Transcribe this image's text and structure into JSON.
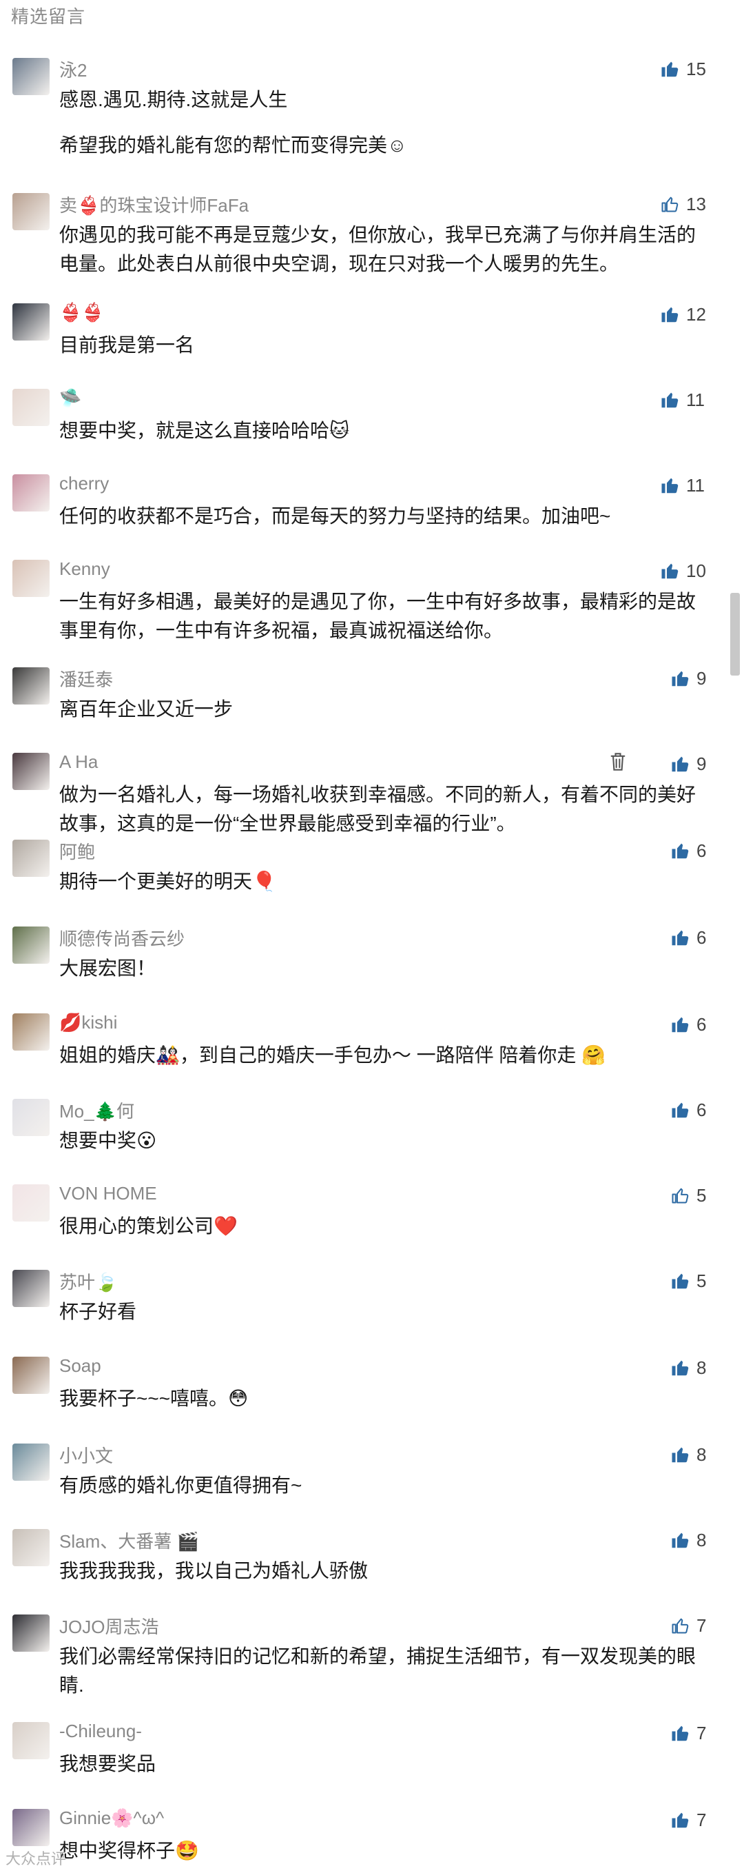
{
  "section_title": "精选留言",
  "comments": [
    {
      "name": "泳2",
      "texts": [
        "感恩.遇见.期待.这就是人生",
        "希望我的婚礼能有您的帮忙而变得完美☺"
      ],
      "likes": "15",
      "liked": true,
      "avatar_color": "#6b7a8c"
    },
    {
      "name": "卖👙的珠宝设计师FaFa",
      "texts": [
        "你遇见的我可能不再是豆蔻少女，但你放心，我早已充满了与你并肩生活的电量。此处表白从前很中央空调，现在只对我一个人暖男的先生。"
      ],
      "likes": "13",
      "liked": false,
      "avatar_color": "#b8a090"
    },
    {
      "name": "👙👙",
      "texts": [
        "目前我是第一名"
      ],
      "likes": "12",
      "liked": true,
      "avatar_color": "#2f3540"
    },
    {
      "name": "🛸",
      "texts": [
        "想要中奖，就是这么直接哈哈哈🐱"
      ],
      "likes": "11",
      "liked": true,
      "avatar_color": "#e6d7d0"
    },
    {
      "name": "cherry",
      "texts": [
        "任何的收获都不是巧合，而是每天的努力与坚持的结果。加油吧~"
      ],
      "likes": "11",
      "liked": true,
      "avatar_color": "#c98fa0"
    },
    {
      "name": "Kenny",
      "texts": [
        "一生有好多相遇，最美好的是遇见了你，一生中有好多故事，最精彩的是故事里有你，一生中有许多祝福，最真诚祝福送给你。"
      ],
      "likes": "10",
      "liked": true,
      "avatar_color": "#d9c2b6"
    },
    {
      "name": "潘廷泰",
      "texts": [
        "离百年企业又近一步"
      ],
      "likes": "9",
      "liked": true,
      "avatar_color": "#3a3a3a"
    },
    {
      "name": "A Ha",
      "texts": [
        "做为一名婚礼人，每一场婚礼收获到幸福感。不同的新人，有着不同的美好故事，这真的是一份“全世界最能感受到幸福的行业”。"
      ],
      "likes": "9",
      "liked": true,
      "avatar_color": "#4a3a40",
      "deletable": true
    },
    {
      "name": "阿鲍",
      "texts": [
        "期待一个更美好的明天🎈"
      ],
      "likes": "6",
      "liked": true,
      "avatar_color": "#b0a8a0"
    },
    {
      "name": "顺德传尚香云纱",
      "texts": [
        "大展宏图！"
      ],
      "likes": "6",
      "liked": true,
      "avatar_color": "#5f6f4a"
    },
    {
      "name": "💋kishi",
      "texts": [
        "姐姐的婚庆🎎，到自己的婚庆一手包办～ 一路陪伴 陪着你走 🤗"
      ],
      "likes": "6",
      "liked": true,
      "avatar_color": "#a08060"
    },
    {
      "name": "Mo_🌲何",
      "texts": [
        "想要中奖😮"
      ],
      "likes": "6",
      "liked": true,
      "avatar_color": "#e0e0e6"
    },
    {
      "name": "VON HOME",
      "texts": [
        "很用心的策划公司❤️"
      ],
      "likes": "5",
      "liked": false,
      "avatar_color": "#f2e4e6"
    },
    {
      "name": "苏叶🍃",
      "texts": [
        "杯子好看"
      ],
      "likes": "5",
      "liked": true,
      "avatar_color": "#4a4a52"
    },
    {
      "name": "Soap",
      "texts": [
        "我要杯子~~~嘻嘻。😳"
      ],
      "likes": "8",
      "liked": true,
      "avatar_color": "#8a6a52"
    },
    {
      "name": "小小文",
      "texts": [
        "有质感的婚礼你更值得拥有~"
      ],
      "likes": "8",
      "liked": true,
      "avatar_color": "#6a8a9a"
    },
    {
      "name": "Slam、大番薯 🎬",
      "texts": [
        "我我我我我，我以自己为婚礼人骄傲"
      ],
      "likes": "8",
      "liked": true,
      "avatar_color": "#c8c0b8"
    },
    {
      "name": "JOJO周志浩",
      "texts": [
        "我们必需经常保持旧的记忆和新的希望，捕捉生活细节，有一双发现美的眼睛."
      ],
      "likes": "7",
      "liked": false,
      "avatar_color": "#2e2e34"
    },
    {
      "name": "-Chileung-",
      "texts": [
        "我想要奖品"
      ],
      "likes": "7",
      "liked": true,
      "avatar_color": "#d8cfc8"
    },
    {
      "name": "Ginnie🌸^ω^",
      "texts": [
        "想中奖得杯子🤩"
      ],
      "likes": "7",
      "liked": true,
      "avatar_color": "#7a6a8a"
    }
  ],
  "watermark": "大众点评",
  "colors": {
    "like_active": "#2b5e8c",
    "like_inactive": "#3a6ea0",
    "meta": "#888888"
  }
}
